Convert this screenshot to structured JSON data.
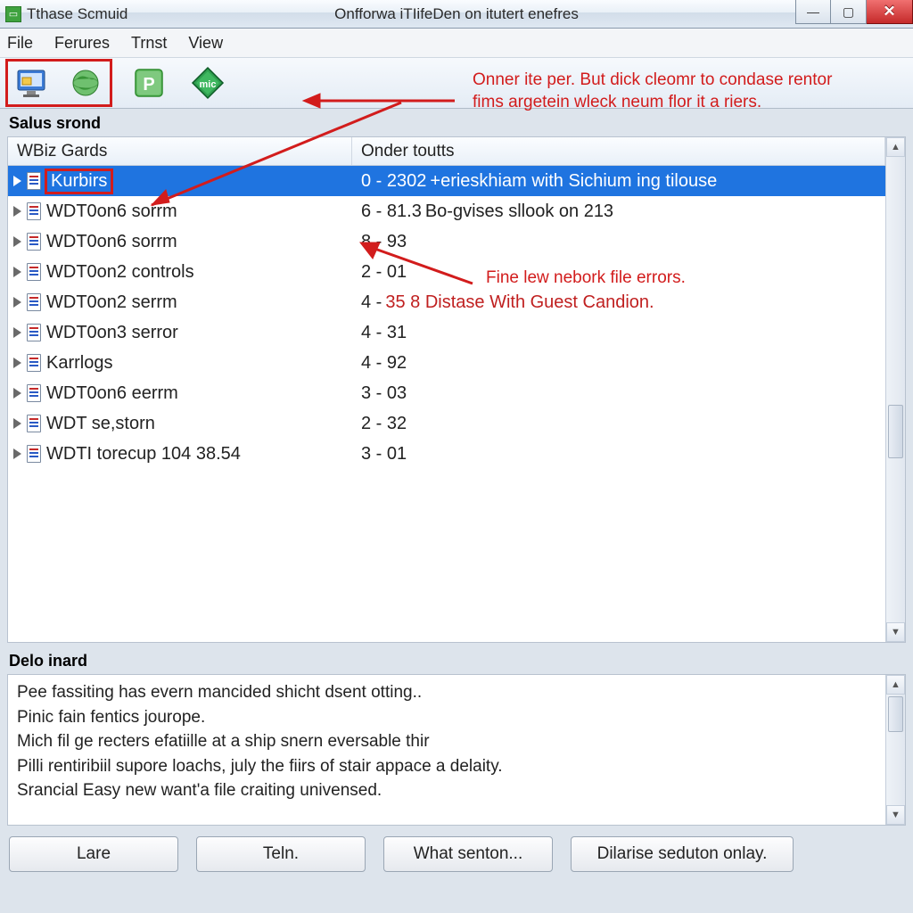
{
  "title_left": "Tthase Scmuid",
  "title_center": "Onfforwa iTIifeDen on itutert enefres",
  "menu": {
    "file": "File",
    "ferures": "Ferures",
    "trnst": "Trnst",
    "view": "View"
  },
  "section_label": "Salus srond",
  "columns": {
    "c1": "WBiz Gards",
    "c2": "Onder toutts"
  },
  "rows": [
    {
      "name": "Kurbirs",
      "val": "0 - 2302",
      "extra": "+erieskhiam with Sichium ing tilouse",
      "selected": true
    },
    {
      "name": "WDT0on6 sorrm",
      "val": "6 - 81.3",
      "extra": "Bo-gvises sllook on 213"
    },
    {
      "name": "WDT0on6 sorrm",
      "val": "8 - 93",
      "extra": ""
    },
    {
      "name": "WDT0on2 controls",
      "val": "2 - 01",
      "extra": ""
    },
    {
      "name": "WDT0on2 serrm",
      "val": "4 -",
      "extra": "35 8 Distase With Guest Candion.",
      "extra_red": true
    },
    {
      "name": "WDT0on3 serror",
      "val": "4 - 31",
      "extra": ""
    },
    {
      "name": "Karrlogs",
      "val": "4 - 92",
      "extra": ""
    },
    {
      "name": "WDT0on6 eerrm",
      "val": "3 - 03",
      "extra": ""
    },
    {
      "name": "WDT se,storn",
      "val": "2 - 32",
      "extra": ""
    },
    {
      "name": "WDTI torecup  104 38.54",
      "val": "3 - 01",
      "extra": ""
    }
  ],
  "annotations": {
    "top": "Onner ite per. But dick cleomr to condase rentor fims argetein wleck neum flor it a riers.",
    "mid": "Fine lew nebork file errors."
  },
  "detail_label": "Delo inard",
  "detail_lines": [
    "Pee fassiting has evern mancided shicht dsent otting..",
    "Pinic fain fentics jourope.",
    "Mich fil ge recters efatiille at a ship snern eversable thir",
    "Pilli rentiribiil supore loachs, july the fiirs of stair appace a delaity.",
    "Srancial Easy new want'a file craiting univensed."
  ],
  "buttons": {
    "b1": "Lare",
    "b2": "Teln.",
    "b3": "What senton...",
    "b4": "Dilarise seduton onlay."
  }
}
